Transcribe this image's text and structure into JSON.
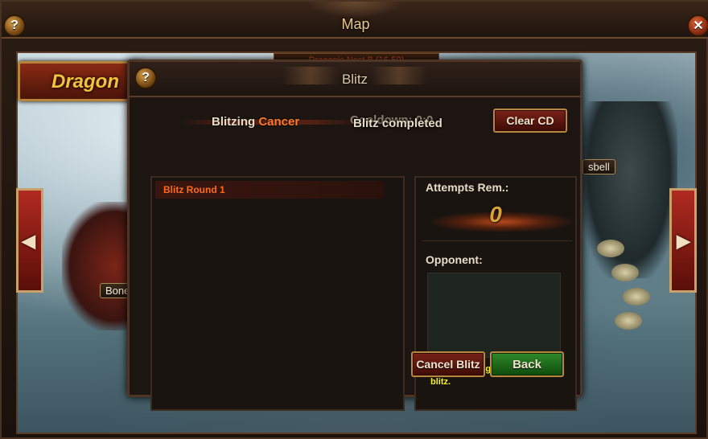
{
  "map_window": {
    "title": "Map",
    "help_icon": "question-mark-icon",
    "close_icon": "close-icon",
    "location_box": "Dragonic Nest B (16-50)",
    "region_banner": "Dragon",
    "labels": {
      "bone": "Bone",
      "sbell": "sbell"
    },
    "nav_left_icon": "arrow-left-icon",
    "nav_right_icon": "arrow-right-icon"
  },
  "blitz": {
    "title": "Blitz",
    "help_icon": "question-mark-icon",
    "status_prefix": "Blitzing",
    "status_target": "Cancer",
    "cooldown_text": "Cooldown: 0:0",
    "completed_text": "Blitz completed",
    "clear_cd_label": "Clear CD",
    "log": [
      {
        "text": "Blitz Round 1"
      }
    ],
    "attempts_label": "Attempts Rem.:",
    "attempts_value": "0",
    "opponent_label": "Opponent:",
    "notice": "Returning to game will not end blitz.",
    "cancel_label": "Cancel Blitz",
    "back_label": "Back"
  },
  "colors": {
    "accent_orange": "#ff7a2a",
    "notice_yellow": "#f4ee2a",
    "gold": "#d8a23a"
  }
}
